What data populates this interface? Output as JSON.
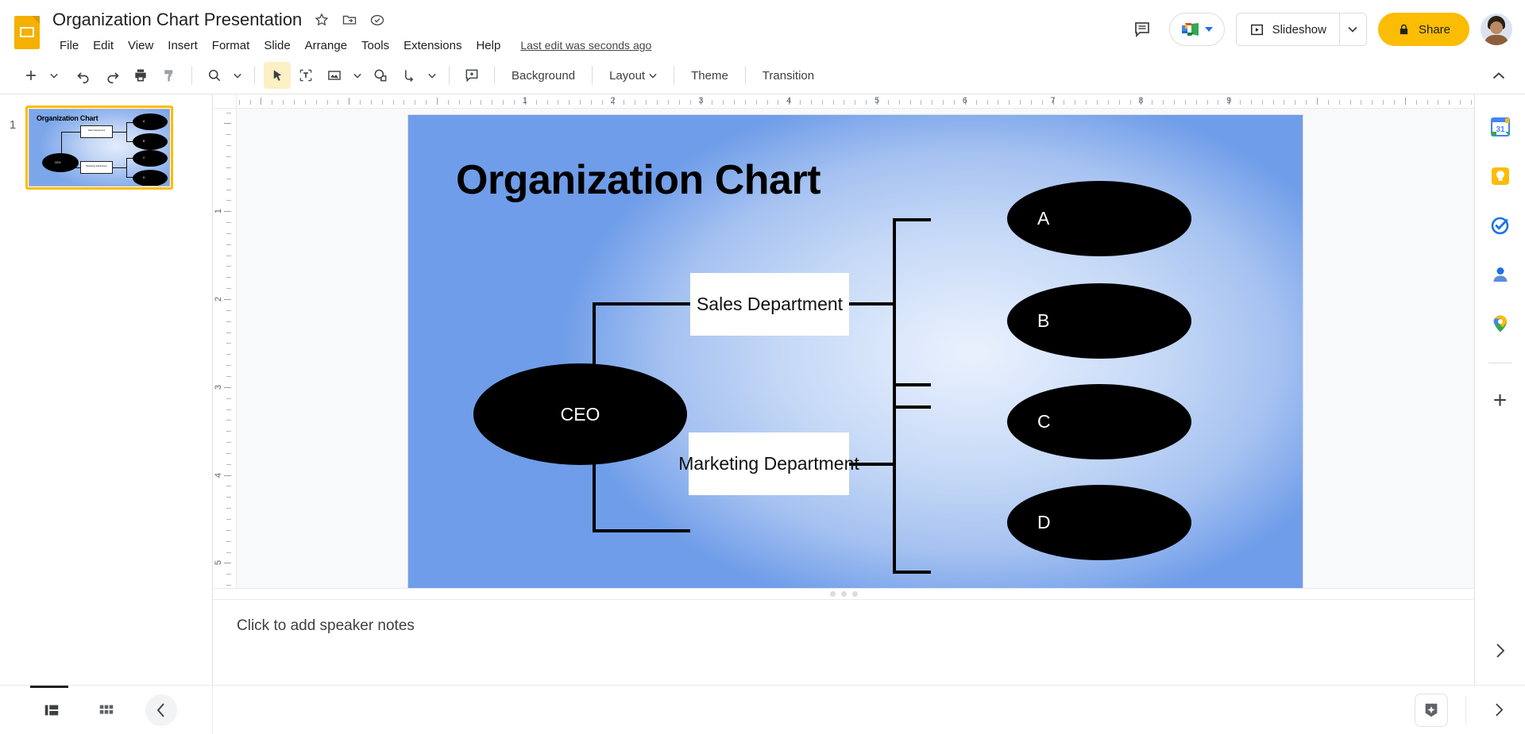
{
  "app": {
    "logo_icon": "google-slides-icon",
    "doc_title": "Organization Chart Presentation",
    "title_icons": [
      {
        "name": "star-icon",
        "glyph": "star"
      },
      {
        "name": "move-to-folder-icon",
        "glyph": "folder-move"
      },
      {
        "name": "cloud-saved-icon",
        "glyph": "cloud-check"
      }
    ],
    "menu_items": [
      "File",
      "Edit",
      "View",
      "Insert",
      "Format",
      "Slide",
      "Arrange",
      "Tools",
      "Extensions",
      "Help"
    ],
    "last_edit": "Last edit was seconds ago"
  },
  "header_right": {
    "comment_icon": "comment-history-icon",
    "meet_icon": "google-meet-icon",
    "slideshow_label": "Slideshow",
    "slideshow_icon": "present-icon",
    "slideshow_caret_icon": "chevron-down-icon",
    "share_label": "Share",
    "share_lock_icon": "lock-icon",
    "avatar_name": "account-avatar"
  },
  "toolbar": {
    "buttons": [
      {
        "name": "new-slide-button",
        "icon": "plus-icon"
      },
      {
        "name": "new-slide-caret",
        "icon": "chevron-down-icon"
      },
      {
        "name": "undo-button",
        "icon": "undo-icon"
      },
      {
        "name": "redo-button",
        "icon": "redo-icon"
      },
      {
        "name": "print-button",
        "icon": "print-icon"
      },
      {
        "name": "paint-format-button",
        "icon": "paint-format-icon"
      },
      {
        "name": "zoom-button",
        "icon": "zoom-icon"
      },
      {
        "name": "zoom-caret",
        "icon": "chevron-down-icon"
      },
      {
        "name": "select-tool-button",
        "icon": "cursor-arrow-icon"
      },
      {
        "name": "text-box-button",
        "icon": "text-box-icon"
      },
      {
        "name": "insert-image-button",
        "icon": "image-icon"
      },
      {
        "name": "insert-image-caret",
        "icon": "chevron-down-icon"
      },
      {
        "name": "shape-button",
        "icon": "shape-icon"
      },
      {
        "name": "line-button",
        "icon": "line-icon"
      },
      {
        "name": "line-caret",
        "icon": "chevron-down-icon"
      },
      {
        "name": "comment-button",
        "icon": "add-comment-icon"
      }
    ],
    "background_label": "Background",
    "layout_label": "Layout",
    "theme_label": "Theme",
    "transition_label": "Transition",
    "collapse_icon": "chevron-up-icon"
  },
  "filmstrip": {
    "slides": [
      {
        "number": "1",
        "title": "Organization Chart",
        "selected": true
      }
    ]
  },
  "rulers": {
    "horizontal_labels": [
      "1",
      "2",
      "3",
      "4",
      "5",
      "6",
      "7",
      "8",
      "9"
    ],
    "vertical_labels": [
      "1",
      "2",
      "3",
      "4",
      "5"
    ]
  },
  "chart_data": {
    "type": "diagram",
    "diagram_kind": "organization-chart",
    "title": "Organization Chart",
    "orientation": "left-to-right",
    "nodes": [
      {
        "id": "ceo",
        "label": "CEO",
        "shape": "ellipse",
        "fill": "#000000",
        "text_color": "#ffffff",
        "level": 0
      },
      {
        "id": "sales",
        "label": "Sales Department",
        "shape": "rectangle",
        "fill": "#ffffff",
        "text_color": "#111111",
        "level": 1
      },
      {
        "id": "marketing",
        "label": "Marketing Department",
        "shape": "rectangle",
        "fill": "#ffffff",
        "text_color": "#111111",
        "level": 1
      },
      {
        "id": "a",
        "label": "A",
        "shape": "ellipse",
        "fill": "#000000",
        "text_color": "#ffffff",
        "level": 2
      },
      {
        "id": "b",
        "label": "B",
        "shape": "ellipse",
        "fill": "#000000",
        "text_color": "#ffffff",
        "level": 2
      },
      {
        "id": "c",
        "label": "C",
        "shape": "ellipse",
        "fill": "#000000",
        "text_color": "#ffffff",
        "level": 2
      },
      {
        "id": "d",
        "label": "D",
        "shape": "ellipse",
        "fill": "#000000",
        "text_color": "#ffffff",
        "level": 2
      }
    ],
    "edges": [
      {
        "from": "ceo",
        "to": "sales"
      },
      {
        "from": "ceo",
        "to": "marketing"
      },
      {
        "from": "sales",
        "to": "a"
      },
      {
        "from": "sales",
        "to": "b"
      },
      {
        "from": "marketing",
        "to": "c"
      },
      {
        "from": "marketing",
        "to": "d"
      }
    ],
    "background": {
      "type": "radial-gradient",
      "center_color": "#eaf1fd",
      "edge_color": "#6f9de9"
    },
    "connector_color": "#000000"
  },
  "notes": {
    "placeholder": "Click to add speaker notes"
  },
  "rail": {
    "icons": [
      {
        "name": "google-calendar-icon",
        "label": "31"
      },
      {
        "name": "google-keep-icon",
        "label": ""
      },
      {
        "name": "google-tasks-icon",
        "label": ""
      },
      {
        "name": "google-contacts-icon",
        "label": ""
      },
      {
        "name": "google-maps-icon",
        "label": ""
      }
    ],
    "add_on_icon": "plus-icon",
    "expand_icon": "chevron-right-icon"
  },
  "bottombar": {
    "filmstrip_view_icon": "filmstrip-view-icon",
    "grid_view_icon": "grid-view-icon",
    "collapse_panel_icon": "chevron-left-icon",
    "explore_icon": "explore-sparkle-icon",
    "expand_icon": "chevron-right-icon"
  }
}
